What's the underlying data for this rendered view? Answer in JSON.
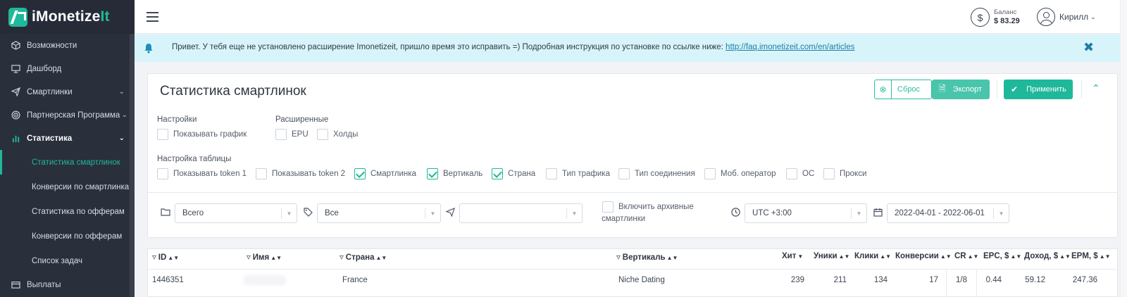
{
  "app": {
    "logo_main": "iMonetize",
    "logo_accent": "It"
  },
  "sidebar": {
    "items": [
      {
        "label": "Возможности",
        "icon": "cube-icon"
      },
      {
        "label": "Дашборд",
        "icon": "monitor-icon"
      },
      {
        "label": "Смартлинки",
        "icon": "send-icon"
      },
      {
        "label": "Партнерская Программа",
        "icon": "target-icon"
      },
      {
        "label": "Статистика",
        "icon": "chart-bars-icon"
      }
    ],
    "sub_items": [
      {
        "label": "Статистика смартлинок"
      },
      {
        "label": "Конверсии по смартлинкам"
      },
      {
        "label": "Статистика по офферам"
      },
      {
        "label": "Конверсии по офферам"
      },
      {
        "label": "Список задач"
      }
    ],
    "bottom_item": {
      "label": "Выплаты",
      "icon": "wallet-icon"
    }
  },
  "topbar": {
    "balance_label": "Баланс",
    "balance_value": "$ 83.29",
    "user_name": "Кирилл"
  },
  "alert": {
    "text": "Привет. У тебя еще не установлено расширение Imonetizeit, пришло время это исправить =) Подробная инструкция по установке по ссылке ниже: ",
    "link": "http://faq.imonetizeit.com/en/articles"
  },
  "filters": {
    "title": "Статистика смартлинок",
    "reset_label": "Сброс",
    "export_label": "Экспорт",
    "apply_label": "Применить",
    "settings_label": "Настройки",
    "show_chart": "Показывать график",
    "extended_label": "Расширенные",
    "epu": "EPU",
    "holds": "Холды",
    "table_settings_label": "Настройка таблицы",
    "table_options": [
      {
        "label": "Показывать token 1",
        "checked": false
      },
      {
        "label": "Показывать token 2",
        "checked": false
      },
      {
        "label": "Смартлинка",
        "checked": true
      },
      {
        "label": "Вертикаль",
        "checked": true
      },
      {
        "label": "Страна",
        "checked": true
      },
      {
        "label": "Тип трафика",
        "checked": false
      },
      {
        "label": "Тип соединения",
        "checked": false
      },
      {
        "label": "Моб. оператор",
        "checked": false
      },
      {
        "label": "ОС",
        "checked": false
      },
      {
        "label": "Прокси",
        "checked": false
      }
    ],
    "group_select": "Всего",
    "tag_select": "Все",
    "smartlink_select": "",
    "archive_line1": "Включить архивные",
    "archive_line2": "смартлинки",
    "timezone": "UTC +3:00",
    "date_range": "2022-04-01 - 2022-06-01"
  },
  "table": {
    "headers": {
      "id": "ID",
      "name": "Имя",
      "country": "Страна",
      "vertical": "Вертикаль",
      "hits": "Хит",
      "uniques": "Уники",
      "clicks": "Клики",
      "conversions": "Конверсии",
      "cr": "CR",
      "epc": "EPC, $",
      "income": "Доход, $",
      "epm": "EPM, $"
    },
    "rows": [
      {
        "id": "1446351",
        "name": "",
        "country": "France",
        "vertical": "Niche Dating",
        "hits": "239",
        "uniques": "211",
        "clicks": "134",
        "conversions": "17",
        "cr": "1/8",
        "epc": "0.44",
        "income": "59.12",
        "epm": "247.36"
      }
    ]
  },
  "colors": {
    "accent": "#1fb89a",
    "sidebar_bg": "#2a2f3c",
    "alert_bg": "#d8f4fb"
  }
}
